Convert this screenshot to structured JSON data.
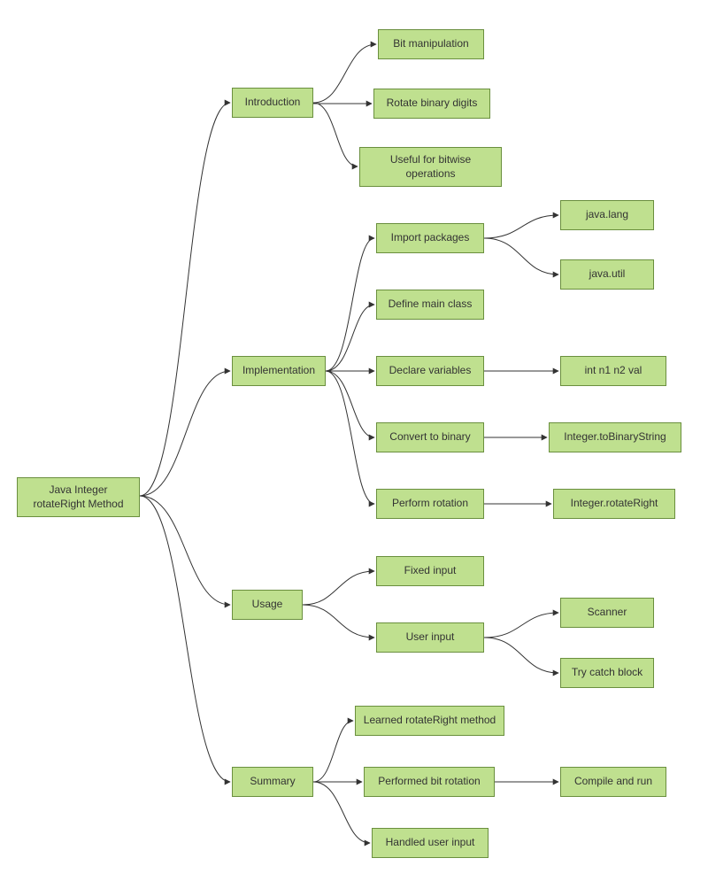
{
  "root": "Java Integer rotateRight Method",
  "intro": {
    "label": "Introduction",
    "c1": "Bit manipulation",
    "c2": "Rotate binary digits",
    "c3": "Useful for bitwise operations"
  },
  "impl": {
    "label": "Implementation",
    "c1": "Import packages",
    "c1a": "java.lang",
    "c1b": "java.util",
    "c2": "Define main class",
    "c3": "Declare variables",
    "c3a": "int n1 n2 val",
    "c4": "Convert to binary",
    "c4a": "Integer.toBinaryString",
    "c5": "Perform rotation",
    "c5a": "Integer.rotateRight"
  },
  "usage": {
    "label": "Usage",
    "c1": "Fixed input",
    "c2": "User input",
    "c2a": "Scanner",
    "c2b": "Try catch block"
  },
  "summary": {
    "label": "Summary",
    "c1": "Learned rotateRight method",
    "c2": "Performed bit rotation",
    "c2a": "Compile and run",
    "c3": "Handled user input"
  }
}
